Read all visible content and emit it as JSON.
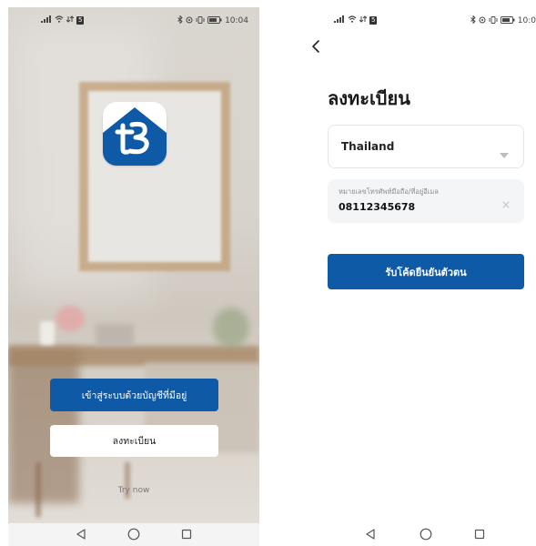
{
  "status_left": {
    "time": "10:04",
    "carrier_badge": "5",
    "icons": [
      "signal-icon",
      "wifi-icon",
      "data-icon"
    ]
  },
  "status_right": {
    "time": "10:0",
    "carrier_badge": "5",
    "icons": [
      "signal-icon",
      "wifi-icon",
      "data-icon"
    ]
  },
  "welcome": {
    "app_icon": "tb-logo-icon",
    "login_button": "เข้าสู่ระบบด้วยบัญชีที่มีอยู่",
    "register_button": "ลงทะเบียน",
    "try_now": "Try now",
    "colors": {
      "primary": "#0f5aa6",
      "button_light": "#ffffff"
    }
  },
  "register": {
    "title": "ลงทะเบียน",
    "country": "Thailand",
    "phone_placeholder": "หมายเลขโทรศัพท์มือถือ/ที่อยู่อีเมล",
    "phone_value": "08112345678",
    "get_code_button": "รับโค้ดยืนยันตัวตน",
    "colors": {
      "primary": "#0f5aa6",
      "field_bg": "#f4f5f7"
    }
  },
  "nav": {
    "icons": [
      "back-triangle-icon",
      "home-circle-icon",
      "recents-square-icon"
    ]
  }
}
